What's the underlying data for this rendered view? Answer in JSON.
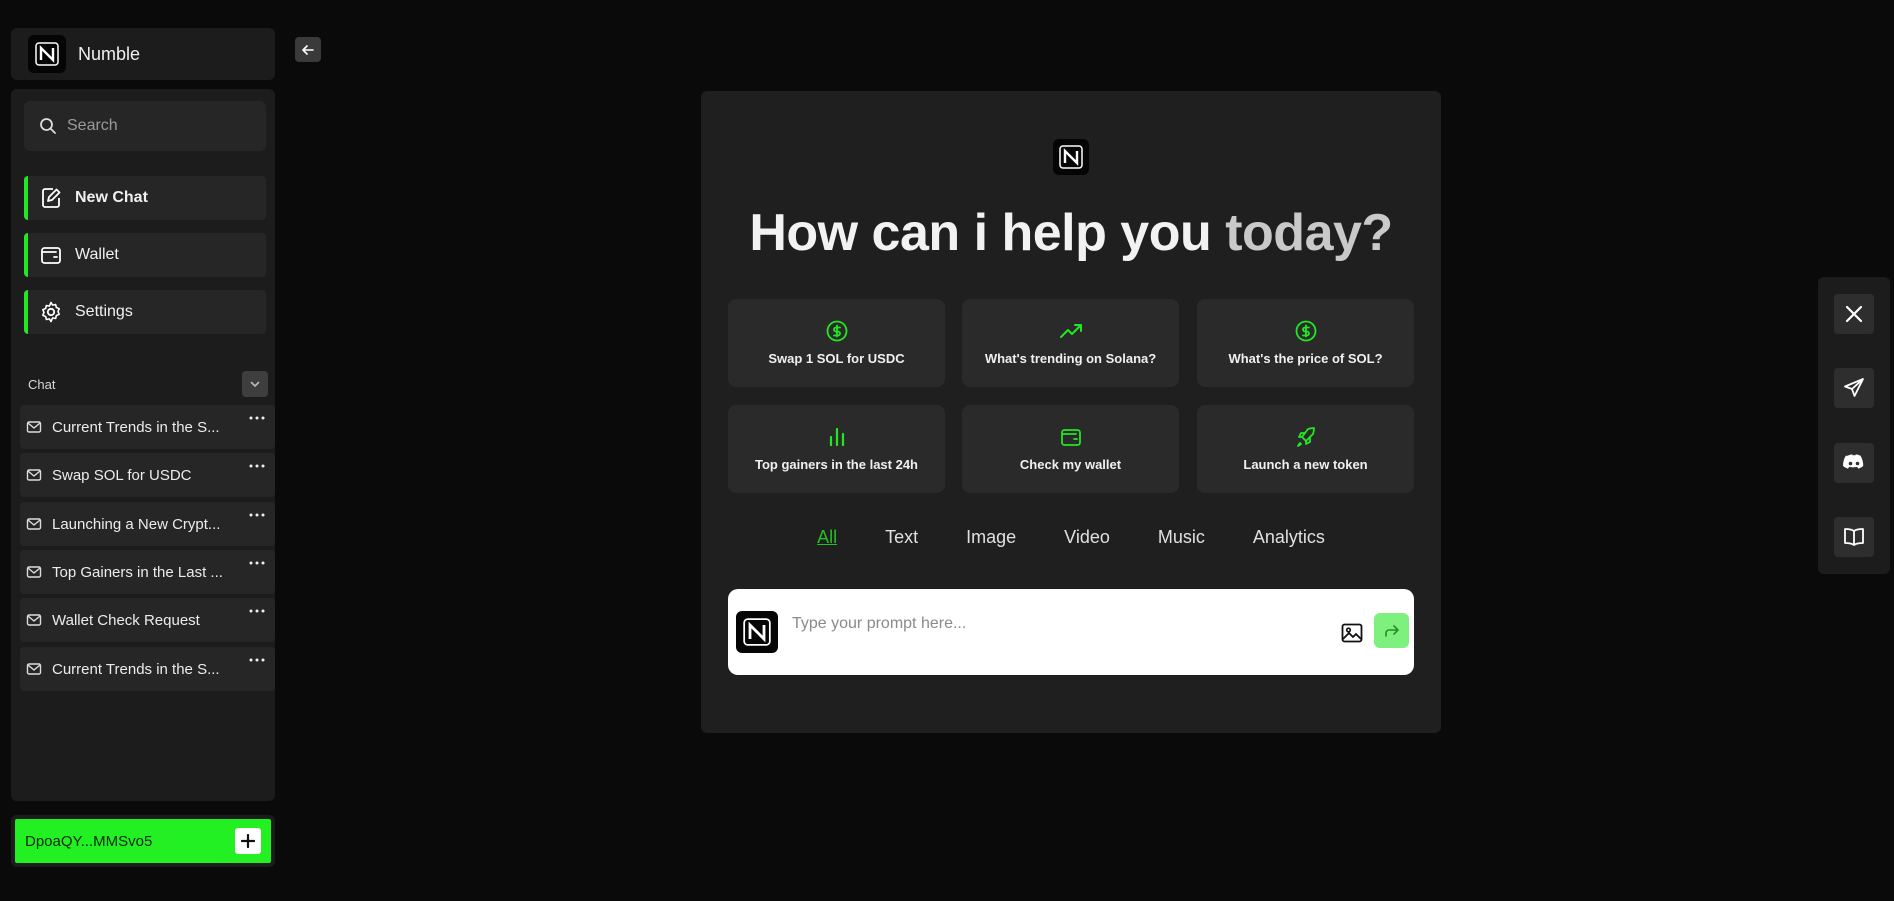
{
  "brand": {
    "name": "Numble"
  },
  "sidebar": {
    "search_placeholder": "Search",
    "nav": [
      {
        "label": "New Chat",
        "icon": "edit-icon"
      },
      {
        "label": "Wallet",
        "icon": "wallet-icon"
      },
      {
        "label": "Settings",
        "icon": "gear-icon"
      }
    ],
    "chat_section_title": "Chat",
    "chats": [
      "Current Trends in the S...",
      "Swap SOL for USDC",
      "Launching a New Crypt...",
      "Top Gainers in the Last ...",
      "Wallet Check Request",
      "Current Trends in the S..."
    ],
    "wallet_address": "DpoaQY...MMSvo5"
  },
  "main": {
    "heading_part1": "How can i help you",
    "heading_part2": "today?",
    "suggestions": [
      {
        "label": "Swap 1 SOL for USDC",
        "icon": "dollar-circle-icon"
      },
      {
        "label": "What's trending on Solana?",
        "icon": "trending-up-icon"
      },
      {
        "label": "What's the price of SOL?",
        "icon": "dollar-circle-icon"
      },
      {
        "label": "Top gainers in the last 24h",
        "icon": "bar-chart-icon"
      },
      {
        "label": "Check my wallet",
        "icon": "wallet-icon"
      },
      {
        "label": "Launch a new token",
        "icon": "rocket-icon"
      }
    ],
    "tabs": [
      "All",
      "Text",
      "Image",
      "Video",
      "Music",
      "Analytics"
    ],
    "active_tab": "All",
    "prompt_placeholder": "Type your prompt here..."
  },
  "social": [
    "x-icon",
    "telegram-icon",
    "discord-icon",
    "book-icon"
  ],
  "colors": {
    "accent": "#22e822",
    "background": "#0a0a0a",
    "panel": "#1f1f1f",
    "card": "#2a2a2a"
  }
}
